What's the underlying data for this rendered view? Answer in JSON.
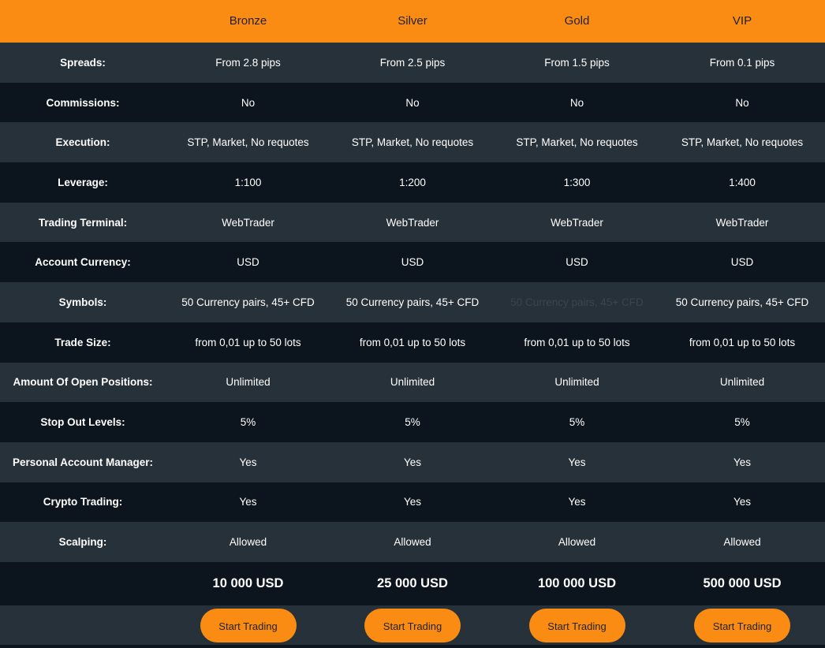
{
  "header": {
    "plans": [
      "Bronze",
      "Silver",
      "Gold",
      "VIP"
    ]
  },
  "rows": [
    {
      "label": "Spreads:",
      "values": [
        "From 2.8 pips",
        "From 2.5 pips",
        "From 1.5 pips",
        "From 0.1 pips"
      ]
    },
    {
      "label": "Commissions:",
      "values": [
        "No",
        "No",
        "No",
        "No"
      ]
    },
    {
      "label": "Execution:",
      "values": [
        "STP, Market, No requotes",
        "STP, Market, No requotes",
        "STP, Market, No requotes",
        "STP, Market, No requotes"
      ]
    },
    {
      "label": "Leverage:",
      "values": [
        "1:100",
        "1:200",
        "1:300",
        "1:400"
      ]
    },
    {
      "label": "Trading Terminal:",
      "values": [
        "WebTrader",
        "WebTrader",
        "WebTrader",
        "WebTrader"
      ]
    },
    {
      "label": "Account Currency:",
      "values": [
        "USD",
        "USD",
        "USD",
        "USD"
      ]
    },
    {
      "label": "Symbols:",
      "values": [
        "50 Currency pairs, 45+ CFD",
        "50 Currency pairs, 45+ CFD",
        "50 Currency pairs, 45+ CFD",
        "50 Currency pairs, 45+ CFD"
      ]
    },
    {
      "label": "Trade Size:",
      "values": [
        "from 0,01 up to 50 lots",
        "from 0,01 up to 50 lots",
        "from 0,01 up to 50 lots",
        "from 0,01 up to 50 lots"
      ]
    },
    {
      "label": "Amount Of Open Positions:",
      "values": [
        "Unlimited",
        "Unlimited",
        "Unlimited",
        "Unlimited"
      ]
    },
    {
      "label": "Stop Out Levels:",
      "values": [
        "5%",
        "5%",
        "5%",
        "5%"
      ]
    },
    {
      "label": "Personal Account Manager:",
      "values": [
        "Yes",
        "Yes",
        "Yes",
        "Yes"
      ]
    },
    {
      "label": "Crypto Trading:",
      "values": [
        "Yes",
        "Yes",
        "Yes",
        "Yes"
      ]
    },
    {
      "label": "Scalping:",
      "values": [
        "Allowed",
        "Allowed",
        "Allowed",
        "Allowed"
      ]
    }
  ],
  "prices": [
    "10 000 USD",
    "25 000 USD",
    "100 000 USD",
    "500 000 USD"
  ],
  "buttons": [
    "Start Trading",
    "Start Trading",
    "Start Trading",
    "Start Trading"
  ],
  "colors": {
    "accent": "#fb8c13",
    "row_light": "#27313a",
    "row_dark": "#0c151d"
  }
}
